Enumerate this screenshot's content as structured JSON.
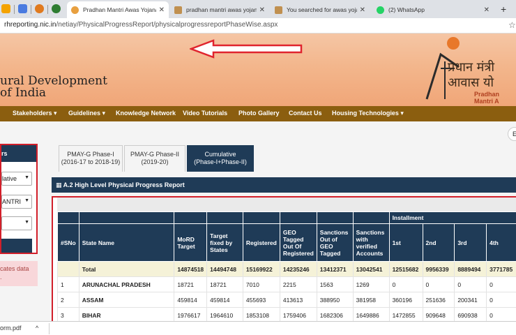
{
  "browser": {
    "tabs": [
      {
        "title": "Pradhan Mantri Awas Yojana",
        "close": "✕",
        "active": true
      },
      {
        "title": "pradhan mantri awas yojana",
        "close": "✕",
        "active": false
      },
      {
        "title": "You searched for awas yojana",
        "close": "✕",
        "active": false
      },
      {
        "title": "(2) WhatsApp",
        "close": "✕",
        "active": false
      }
    ],
    "new_tab": "+",
    "url_host": "rhreporting.nic.in",
    "url_path": "/netiay/PhysicalProgressReport/physicalprogressreportPhaseWise.aspx",
    "star": "☆"
  },
  "banner": {
    "ministry_line1": "ural Development",
    "ministry_line2": "of India",
    "hindi_line1": "प्रधान मंत्री",
    "hindi_line2": "आवास यो",
    "english_logo": "Pradhan Mantri A"
  },
  "nav": {
    "items": [
      "Stakeholders ▾",
      "Guidelines ▾",
      "Knowledge Network",
      "Video Tutorials",
      "Photo Gallery",
      "Contact Us",
      "Housing Technologies ▾"
    ]
  },
  "lang_pill": "E",
  "left_panel": {
    "heading": "rs",
    "select1": "lative",
    "select2": "ANTRI",
    "select3": "",
    "button": "",
    "note_line1": "cates data",
    "note_line2": "."
  },
  "report_tabs": [
    {
      "line1": "PMAY-G Phase-I",
      "line2": "(2016-17 to 2018-19)"
    },
    {
      "line1": "PMAY-G Phase-II",
      "line2": "(2019-20)"
    },
    {
      "line1": "Cumulative",
      "line2": "(Phase-I+Phase-II)"
    }
  ],
  "report_title": "▦ A.2 High Level Physical Progress Report",
  "table": {
    "group_header": "Installment",
    "headers": [
      "#SNo",
      "State Name",
      "MoRD Target",
      "Target fixed by States",
      "Registered",
      "GEO Tagged Out Of Registered",
      "Sanctions Out of GEO Tagged",
      "Sanctions with verified Accounts",
      "1st",
      "2nd",
      "3rd",
      "4th"
    ],
    "rows": [
      {
        "sno": "",
        "state": "Total",
        "vals": [
          "14874518",
          "14494748",
          "15169922",
          "14235246",
          "13412371",
          "13042541",
          "12515682",
          "9956339",
          "8889494",
          "3771785"
        ]
      },
      {
        "sno": "1",
        "state": "ARUNACHAL PRADESH",
        "vals": [
          "18721",
          "18721",
          "7010",
          "2215",
          "1563",
          "1269",
          "0",
          "0",
          "0",
          "0"
        ]
      },
      {
        "sno": "2",
        "state": "ASSAM",
        "vals": [
          "459814",
          "459814",
          "455693",
          "413613",
          "388950",
          "381958",
          "360196",
          "251636",
          "200341",
          "0"
        ]
      },
      {
        "sno": "3",
        "state": "BIHAR",
        "vals": [
          "1976617",
          "1964610",
          "1853108",
          "1759406",
          "1682306",
          "1649886",
          "1472855",
          "909648",
          "690938",
          "0"
        ]
      }
    ]
  },
  "downloads": {
    "file": "orm.pdf",
    "chevron": "^"
  },
  "colors": {
    "navy": "#1f3b57",
    "nav_brown": "#8b5e0f",
    "highlight_red": "#d21f2a",
    "total_row": "#f5f2d8"
  }
}
